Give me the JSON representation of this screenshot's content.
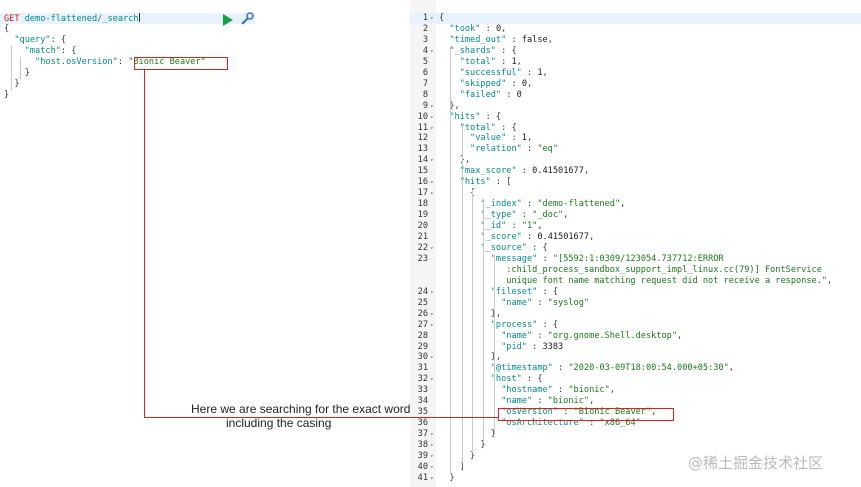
{
  "request": {
    "method": "GET",
    "path": "demo-flattened/_search",
    "lines": [
      [
        [
          "p",
          "{"
        ]
      ],
      [
        [
          "p",
          "  "
        ],
        [
          "k",
          "\"query\""
        ],
        [
          "p",
          ": {"
        ]
      ],
      [
        [
          "p",
          "    "
        ],
        [
          "k",
          "\"match\""
        ],
        [
          "p",
          ": {"
        ]
      ],
      [
        [
          "p",
          "      "
        ],
        [
          "k",
          "\"host.osVersion\""
        ],
        [
          "p",
          ": "
        ],
        [
          "s",
          "\"Bionic Beaver\""
        ]
      ],
      [
        [
          "p",
          "    }"
        ]
      ],
      [
        [
          "p",
          "  }"
        ]
      ],
      [
        [
          "p",
          "}"
        ]
      ]
    ]
  },
  "response": {
    "lines": [
      [
        [
          "p",
          "{"
        ]
      ],
      [
        [
          "p",
          "  "
        ],
        [
          "k",
          "\"took\""
        ],
        [
          "p",
          " : "
        ],
        [
          "n",
          "0"
        ],
        [
          "p",
          ","
        ]
      ],
      [
        [
          "p",
          "  "
        ],
        [
          "k",
          "\"timed_out\""
        ],
        [
          "p",
          " : "
        ],
        [
          "n",
          "false"
        ],
        [
          "p",
          ","
        ]
      ],
      [
        [
          "p",
          "  "
        ],
        [
          "k",
          "\"_shards\""
        ],
        [
          "p",
          " : {"
        ]
      ],
      [
        [
          "p",
          "    "
        ],
        [
          "k",
          "\"total\""
        ],
        [
          "p",
          " : "
        ],
        [
          "n",
          "1"
        ],
        [
          "p",
          ","
        ]
      ],
      [
        [
          "p",
          "    "
        ],
        [
          "k",
          "\"successful\""
        ],
        [
          "p",
          " : "
        ],
        [
          "n",
          "1"
        ],
        [
          "p",
          ","
        ]
      ],
      [
        [
          "p",
          "    "
        ],
        [
          "k",
          "\"skipped\""
        ],
        [
          "p",
          " : "
        ],
        [
          "n",
          "0"
        ],
        [
          "p",
          ","
        ]
      ],
      [
        [
          "p",
          "    "
        ],
        [
          "k",
          "\"failed\""
        ],
        [
          "p",
          " : "
        ],
        [
          "n",
          "0"
        ]
      ],
      [
        [
          "p",
          "  },"
        ]
      ],
      [
        [
          "p",
          "  "
        ],
        [
          "k",
          "\"hits\""
        ],
        [
          "p",
          " : {"
        ]
      ],
      [
        [
          "p",
          "    "
        ],
        [
          "k",
          "\"total\""
        ],
        [
          "p",
          " : {"
        ]
      ],
      [
        [
          "p",
          "      "
        ],
        [
          "k",
          "\"value\""
        ],
        [
          "p",
          " : "
        ],
        [
          "n",
          "1"
        ],
        [
          "p",
          ","
        ]
      ],
      [
        [
          "p",
          "      "
        ],
        [
          "k",
          "\"relation\""
        ],
        [
          "p",
          " : "
        ],
        [
          "s",
          "\"eq\""
        ]
      ],
      [
        [
          "p",
          "    },"
        ]
      ],
      [
        [
          "p",
          "    "
        ],
        [
          "k",
          "\"max_score\""
        ],
        [
          "p",
          " : "
        ],
        [
          "n",
          "0.41501677"
        ],
        [
          "p",
          ","
        ]
      ],
      [
        [
          "p",
          "    "
        ],
        [
          "k",
          "\"hits\""
        ],
        [
          "p",
          " : ["
        ]
      ],
      [
        [
          "p",
          "      {"
        ]
      ],
      [
        [
          "p",
          "        "
        ],
        [
          "k",
          "\"_index\""
        ],
        [
          "p",
          " : "
        ],
        [
          "s",
          "\"demo-flattened\""
        ],
        [
          "p",
          ","
        ]
      ],
      [
        [
          "p",
          "        "
        ],
        [
          "k",
          "\"_type\""
        ],
        [
          "p",
          " : "
        ],
        [
          "s",
          "\"_doc\""
        ],
        [
          "p",
          ","
        ]
      ],
      [
        [
          "p",
          "        "
        ],
        [
          "k",
          "\"_id\""
        ],
        [
          "p",
          " : "
        ],
        [
          "s",
          "\"1\""
        ],
        [
          "p",
          ","
        ]
      ],
      [
        [
          "p",
          "        "
        ],
        [
          "k",
          "\"_score\""
        ],
        [
          "p",
          " : "
        ],
        [
          "n",
          "0.41501677"
        ],
        [
          "p",
          ","
        ]
      ],
      [
        [
          "p",
          "        "
        ],
        [
          "k",
          "\"_source\""
        ],
        [
          "p",
          " : {"
        ]
      ],
      [
        [
          "p",
          "          "
        ],
        [
          "k",
          "\"message\""
        ],
        [
          "p",
          " : "
        ],
        [
          "s",
          "\"[5592:1:0309/123054.737712:ERROR"
        ]
      ],
      [
        [
          "s",
          "             :child_process_sandbox_support_impl_linux.cc(79)] FontService"
        ]
      ],
      [
        [
          "s",
          "             unique font name matching request did not receive a response.\""
        ],
        [
          "p",
          ","
        ]
      ],
      [
        [
          "p",
          "          "
        ],
        [
          "k",
          "\"fileset\""
        ],
        [
          "p",
          " : {"
        ]
      ],
      [
        [
          "p",
          "            "
        ],
        [
          "k",
          "\"name\""
        ],
        [
          "p",
          " : "
        ],
        [
          "s",
          "\"syslog\""
        ]
      ],
      [
        [
          "p",
          "          },"
        ]
      ],
      [
        [
          "p",
          "          "
        ],
        [
          "k",
          "\"process\""
        ],
        [
          "p",
          " : {"
        ]
      ],
      [
        [
          "p",
          "            "
        ],
        [
          "k",
          "\"name\""
        ],
        [
          "p",
          " : "
        ],
        [
          "s",
          "\"org.gnome.Shell.desktop\""
        ],
        [
          "p",
          ","
        ]
      ],
      [
        [
          "p",
          "            "
        ],
        [
          "k",
          "\"pid\""
        ],
        [
          "p",
          " : "
        ],
        [
          "n",
          "3383"
        ]
      ],
      [
        [
          "p",
          "          },"
        ]
      ],
      [
        [
          "p",
          "          "
        ],
        [
          "k",
          "\"@timestamp\""
        ],
        [
          "p",
          " : "
        ],
        [
          "s",
          "\"2020-03-09T18:00:54.000+05:30\""
        ],
        [
          "p",
          ","
        ]
      ],
      [
        [
          "p",
          "          "
        ],
        [
          "k",
          "\"host\""
        ],
        [
          "p",
          " : {"
        ]
      ],
      [
        [
          "p",
          "            "
        ],
        [
          "k",
          "\"hostname\""
        ],
        [
          "p",
          " : "
        ],
        [
          "s",
          "\"bionic\""
        ],
        [
          "p",
          ","
        ]
      ],
      [
        [
          "p",
          "            "
        ],
        [
          "k",
          "\"name\""
        ],
        [
          "p",
          " : "
        ],
        [
          "s",
          "\"bionic\""
        ],
        [
          "p",
          ","
        ]
      ],
      [
        [
          "p",
          "            "
        ],
        [
          "k",
          "\"osVersion\""
        ],
        [
          "p",
          " : "
        ],
        [
          "s",
          "\"Bionic Beaver\""
        ],
        [
          "p",
          ","
        ]
      ],
      [
        [
          "p",
          "            "
        ],
        [
          "k",
          "\"osArchitecture\""
        ],
        [
          "p",
          " : "
        ],
        [
          "s",
          "\"x86_64\""
        ]
      ],
      [
        [
          "p",
          "          }"
        ]
      ],
      [
        [
          "p",
          "        }"
        ]
      ],
      [
        [
          "p",
          "      }"
        ]
      ],
      [
        [
          "p",
          "    ]"
        ]
      ],
      [
        [
          "p",
          "  }"
        ]
      ]
    ],
    "line_numbers": [
      "1",
      "2",
      "3",
      "4",
      "5",
      "6",
      "7",
      "8",
      "9",
      "10",
      "11",
      "12",
      "13",
      "14",
      "15",
      "16",
      "17",
      "18",
      "19",
      "20",
      "21",
      "22",
      "23",
      "",
      "",
      "24",
      "25",
      "26",
      "27",
      "28",
      "29",
      "30",
      "31",
      "32",
      "33",
      "34",
      "35",
      "36",
      "37",
      "38",
      "39",
      "40",
      "41"
    ],
    "folds": [
      "▾",
      "",
      "",
      "▾",
      "",
      "",
      "",
      "",
      "▾",
      "▾",
      "▾",
      "",
      "",
      "▾",
      "",
      "▾",
      "▾",
      "",
      "",
      "",
      "",
      "▾",
      "",
      "",
      "",
      "▾",
      "",
      "▾",
      "▾",
      "",
      "",
      "▾",
      "",
      "▾",
      "",
      "",
      "",
      "",
      "▾",
      "▾",
      "▾",
      "▾",
      "▾"
    ]
  },
  "annotation": {
    "line1": "Here we are searching for the exact word",
    "line2": "including the casing"
  },
  "watermark": "@稀土掘金技术社区",
  "colors": {
    "highlight": "#e0201b",
    "run": "#1a9c4a",
    "key": "#008b8b",
    "string": "#1a7a1a"
  }
}
